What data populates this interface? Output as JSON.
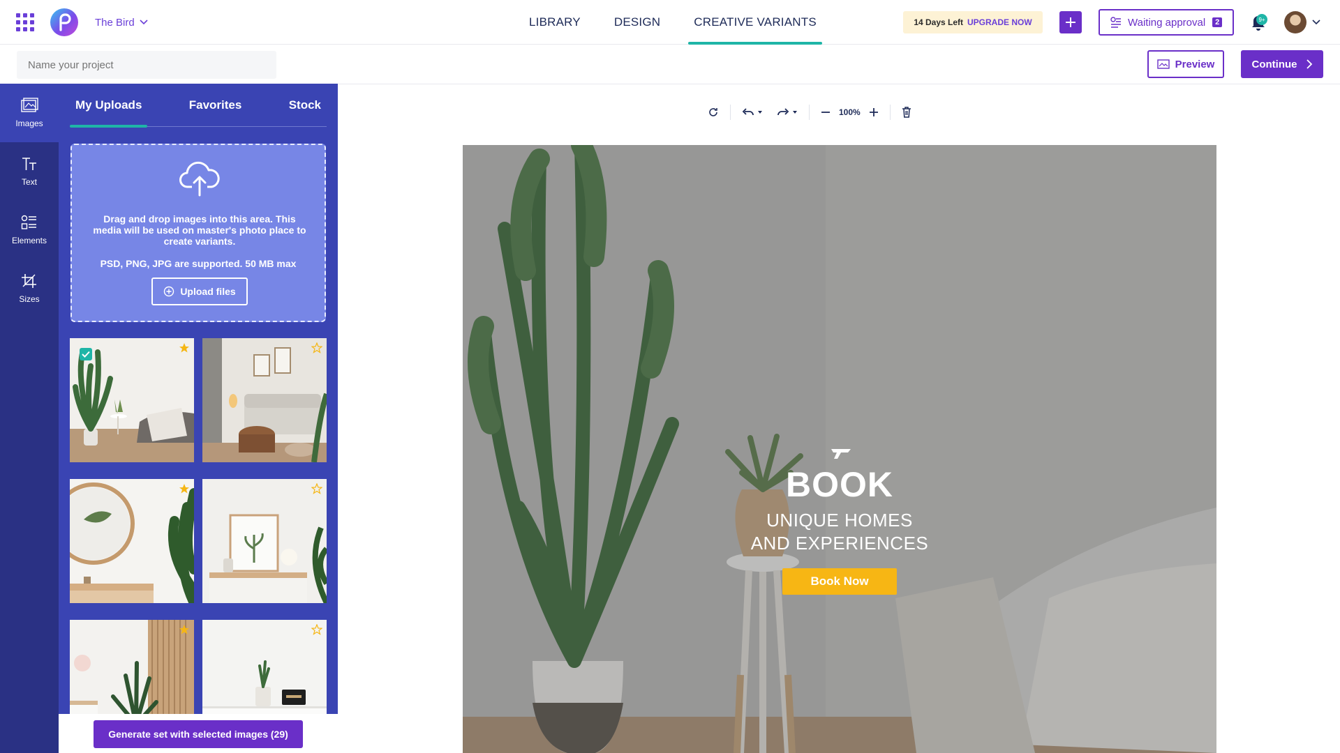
{
  "brand": {
    "workspace_name": "The Bird"
  },
  "nav": {
    "items": [
      "LIBRARY",
      "DESIGN",
      "CREATIVE VARIANTS"
    ],
    "active": "CREATIVE VARIANTS"
  },
  "trial": {
    "days_left": "14 Days Left",
    "upgrade": "UPGRADE NOW"
  },
  "approval": {
    "label": "Waiting approval",
    "count": "2"
  },
  "notifications": {
    "badge": "9+"
  },
  "project": {
    "placeholder": "Name your project"
  },
  "actions": {
    "preview": "Preview",
    "continue": "Continue"
  },
  "rail": {
    "items": [
      "Images",
      "Text",
      "Elements",
      "Sizes"
    ],
    "active": "Images"
  },
  "panel": {
    "tabs": [
      "My Uploads",
      "Favorites",
      "Stock"
    ],
    "active_tab": "My Uploads",
    "dropzone_text": "Drag and drop images into this area. This media will be used on master's photo place to create variants.",
    "supported": "PSD, PNG, JPG are supported. 50 MB max",
    "upload_label": "Upload files",
    "generate_label": "Generate set with selected images (29)"
  },
  "thumbnails": [
    {
      "scene": "plant-sofa",
      "favorite": true,
      "selected": true
    },
    {
      "scene": "living-room",
      "favorite": false,
      "selected": false
    },
    {
      "scene": "mirror-leaf",
      "favorite": true,
      "selected": false
    },
    {
      "scene": "frame-shelf",
      "favorite": false,
      "selected": false
    },
    {
      "scene": "snake-plant",
      "favorite": true,
      "selected": false
    },
    {
      "scene": "small-plant",
      "favorite": false,
      "selected": false
    }
  ],
  "editor": {
    "zoom": "100%"
  },
  "ad": {
    "headline": "BOOK",
    "subline_1": "UNIQUE HOMES",
    "subline_2": "AND EXPERIENCES",
    "cta": "Book Now"
  },
  "colors": {
    "accent": "#6a2fc8",
    "teal": "#1fb5a7",
    "rail": "#2a3184",
    "panel": "#3a44b3",
    "cta": "#f7b614",
    "star": "#f5b614"
  }
}
